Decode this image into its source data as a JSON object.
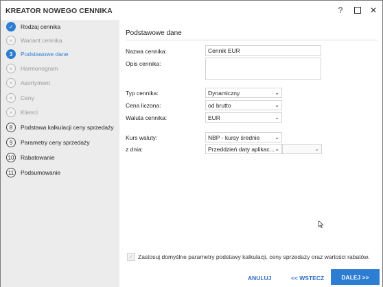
{
  "window": {
    "title": "KREATOR NOWEGO CENNIKA",
    "help_label": "?",
    "close_label": "✕"
  },
  "steps": [
    {
      "label": "Rodzaj cennika",
      "state": "done",
      "marker": "✓"
    },
    {
      "label": "Wariant cennika",
      "state": "skip",
      "marker": "×"
    },
    {
      "label": "Podstawowe dane",
      "state": "current",
      "marker": "3"
    },
    {
      "label": "Harmonogram",
      "state": "skip",
      "marker": "×"
    },
    {
      "label": "Asortyment",
      "state": "skip",
      "marker": "×"
    },
    {
      "label": "Ceny",
      "state": "skip",
      "marker": "×"
    },
    {
      "label": "Klienci",
      "state": "skip",
      "marker": "×"
    },
    {
      "label": "Podstawa kalkulacji ceny sprzedaży",
      "state": "num",
      "marker": "8"
    },
    {
      "label": "Parametry ceny sprzedaży",
      "state": "num",
      "marker": "9"
    },
    {
      "label": "Rabatowanie",
      "state": "num",
      "marker": "10"
    },
    {
      "label": "Podsumowanie",
      "state": "num",
      "marker": "11"
    }
  ],
  "form": {
    "section_title": "Podstawowe dane",
    "nazwa_label": "Nazwa cennika:",
    "nazwa_value": "Cennik EUR",
    "opis_label": "Opis cennika:",
    "opis_value": "",
    "typ_label": "Typ cennika:",
    "typ_value": "Dynamiczny",
    "cena_label": "Cena liczona:",
    "cena_value": "od brutto",
    "waluta_label": "Waluta cennika:",
    "waluta_value": "EUR",
    "kurs_label": "Kurs waluty:",
    "kurs_value": "NBP - kursy średnie",
    "zdnia_label": "z dnia:",
    "zdnia_value": "Przeddzień daty aplikac...",
    "zdnia_date_value": ""
  },
  "checkbox": {
    "label": "Zastosuj domyślne parametry podstawy kalkulacji, ceny sprzedaży oraz wartości rabatów.",
    "checked": true
  },
  "footer": {
    "cancel_label": "ANULUJ",
    "back_label": "<< WSTECZ",
    "next_label": "DALEJ >>"
  },
  "colors": {
    "accent": "#2d7dd2",
    "link": "#2d6cc4",
    "sidebar_bg": "#ececec"
  }
}
